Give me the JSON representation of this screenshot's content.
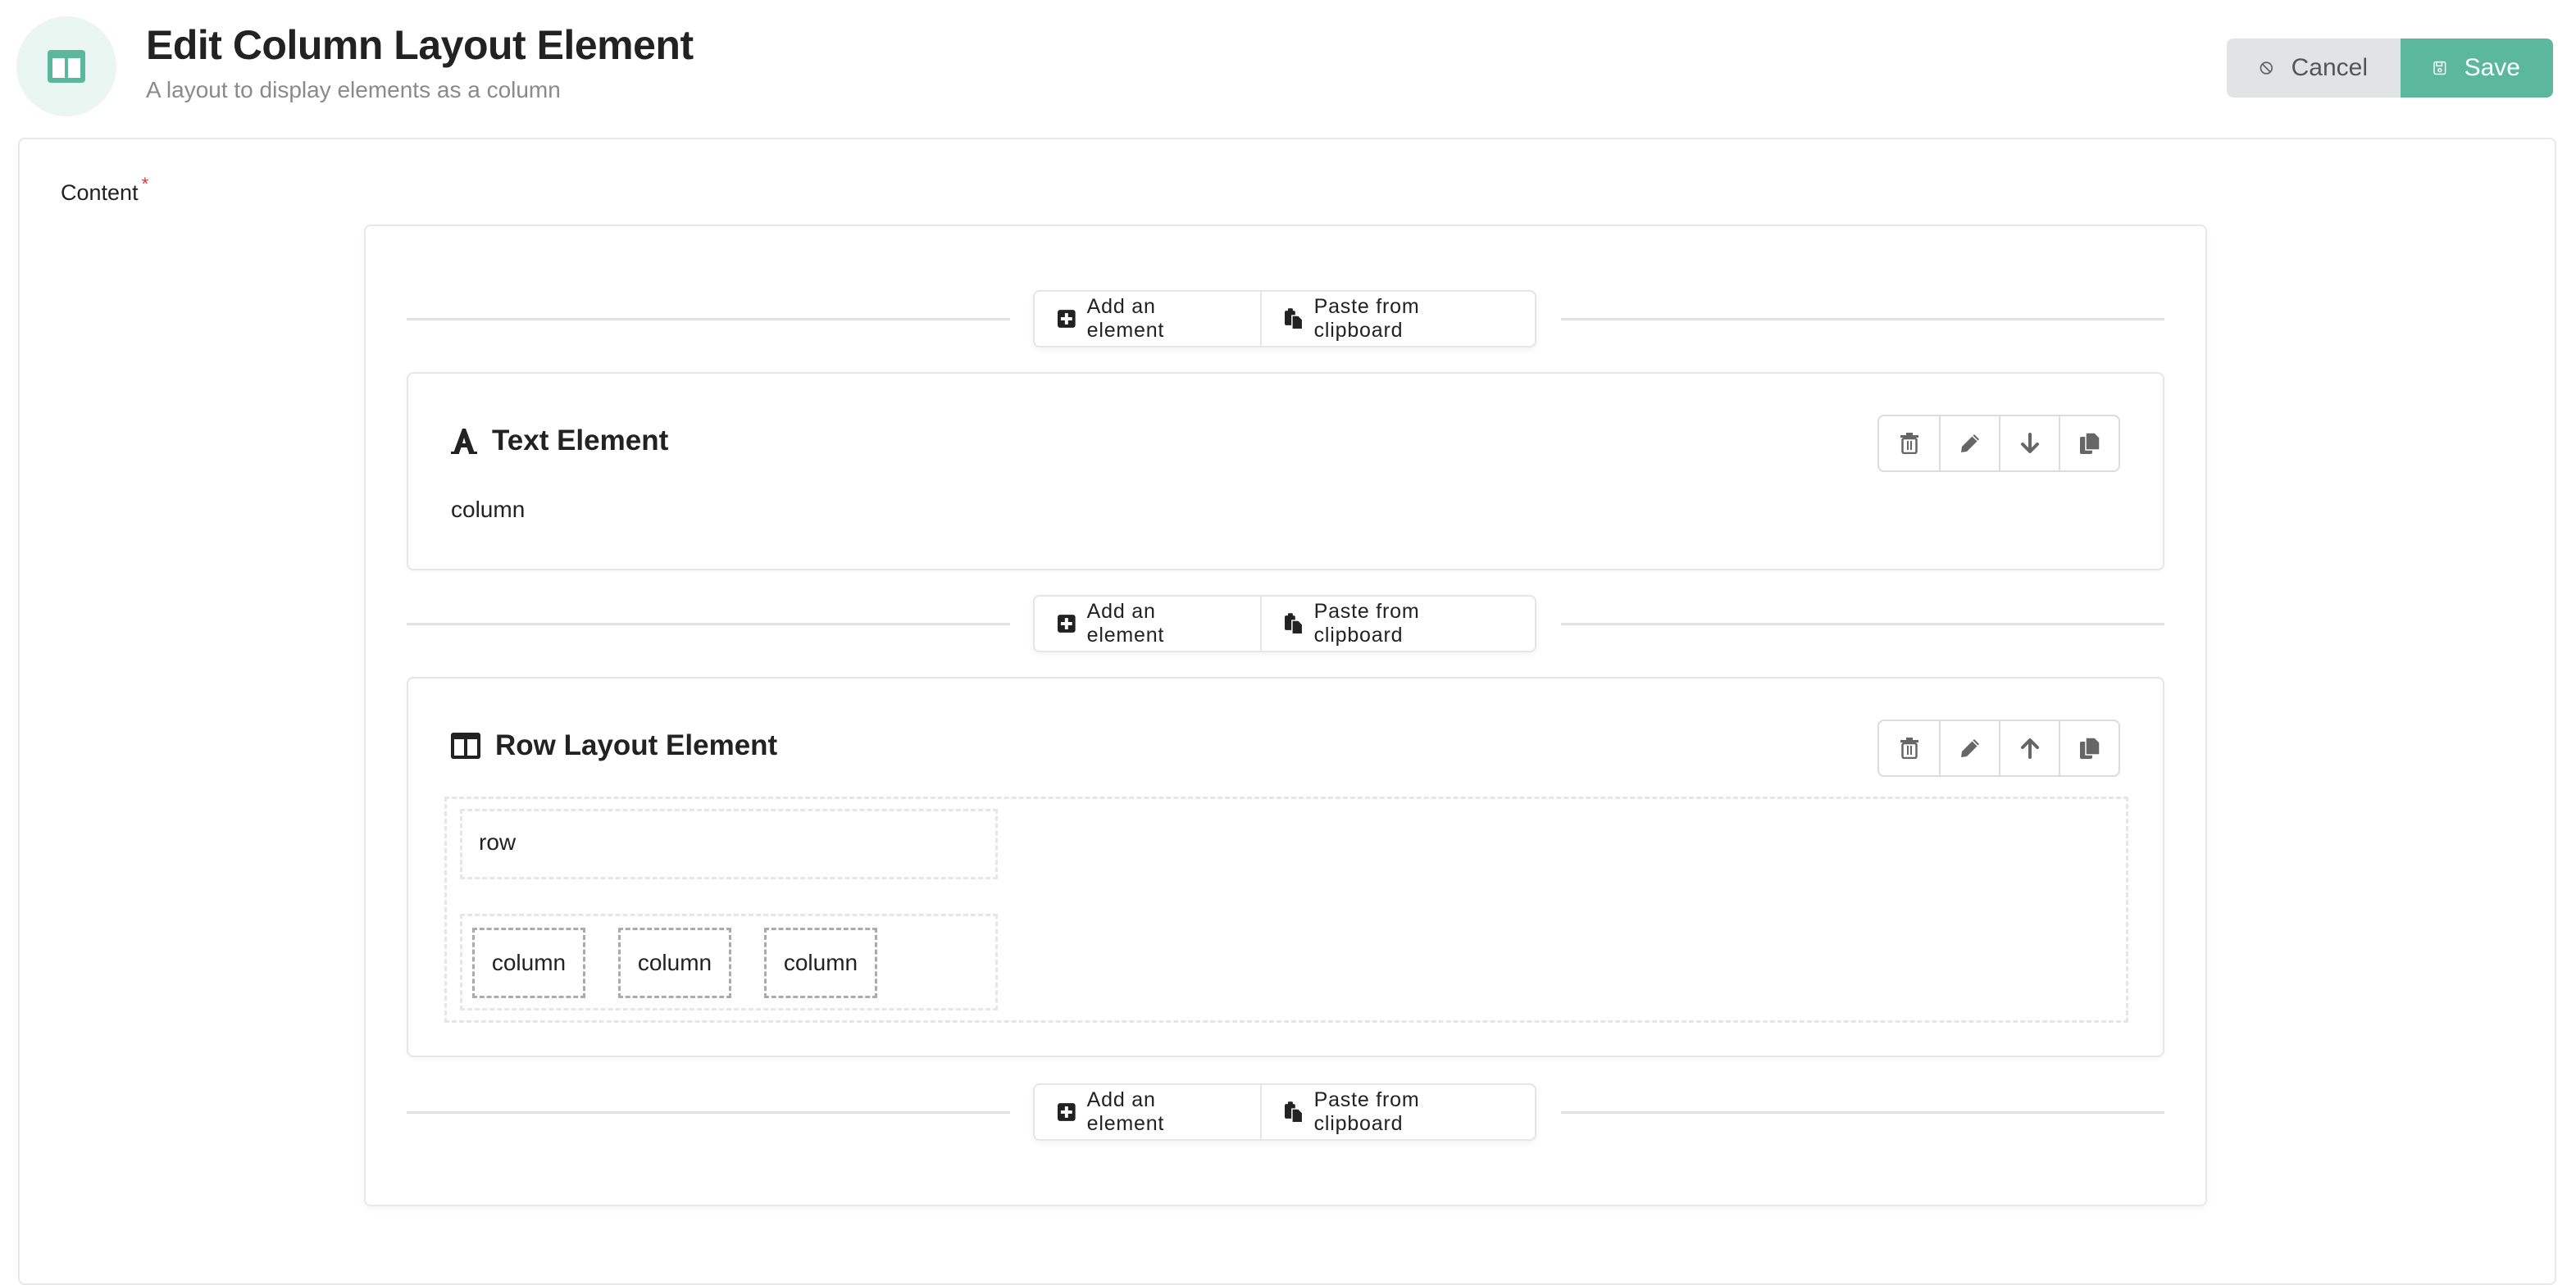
{
  "header": {
    "icon": "columns-icon",
    "title": "Edit Column Layout Element",
    "subtitle": "A layout to display elements as a column",
    "cancel_label": "Cancel",
    "save_label": "Save"
  },
  "colors": {
    "accent": "#5bb89c",
    "accent_light": "#eaf6f1",
    "cancel_bg": "#e2e3e5",
    "required": "#dd3333"
  },
  "form": {
    "content_label": "Content",
    "required_marker": "*"
  },
  "add_bar": {
    "add_label": "Add an element",
    "paste_label": "Paste from clipboard"
  },
  "elements": [
    {
      "title": "Text Element",
      "icon": "font-icon",
      "body": "column",
      "tools": [
        "trash-icon",
        "pencil-icon",
        "arrow-down-icon",
        "copy-icon"
      ]
    },
    {
      "title": "Row Layout Element",
      "icon": "columns-icon",
      "row_text": "row",
      "columns": [
        "column",
        "column",
        "column"
      ],
      "tools": [
        "trash-icon",
        "pencil-icon",
        "arrow-up-icon",
        "copy-icon"
      ]
    }
  ]
}
